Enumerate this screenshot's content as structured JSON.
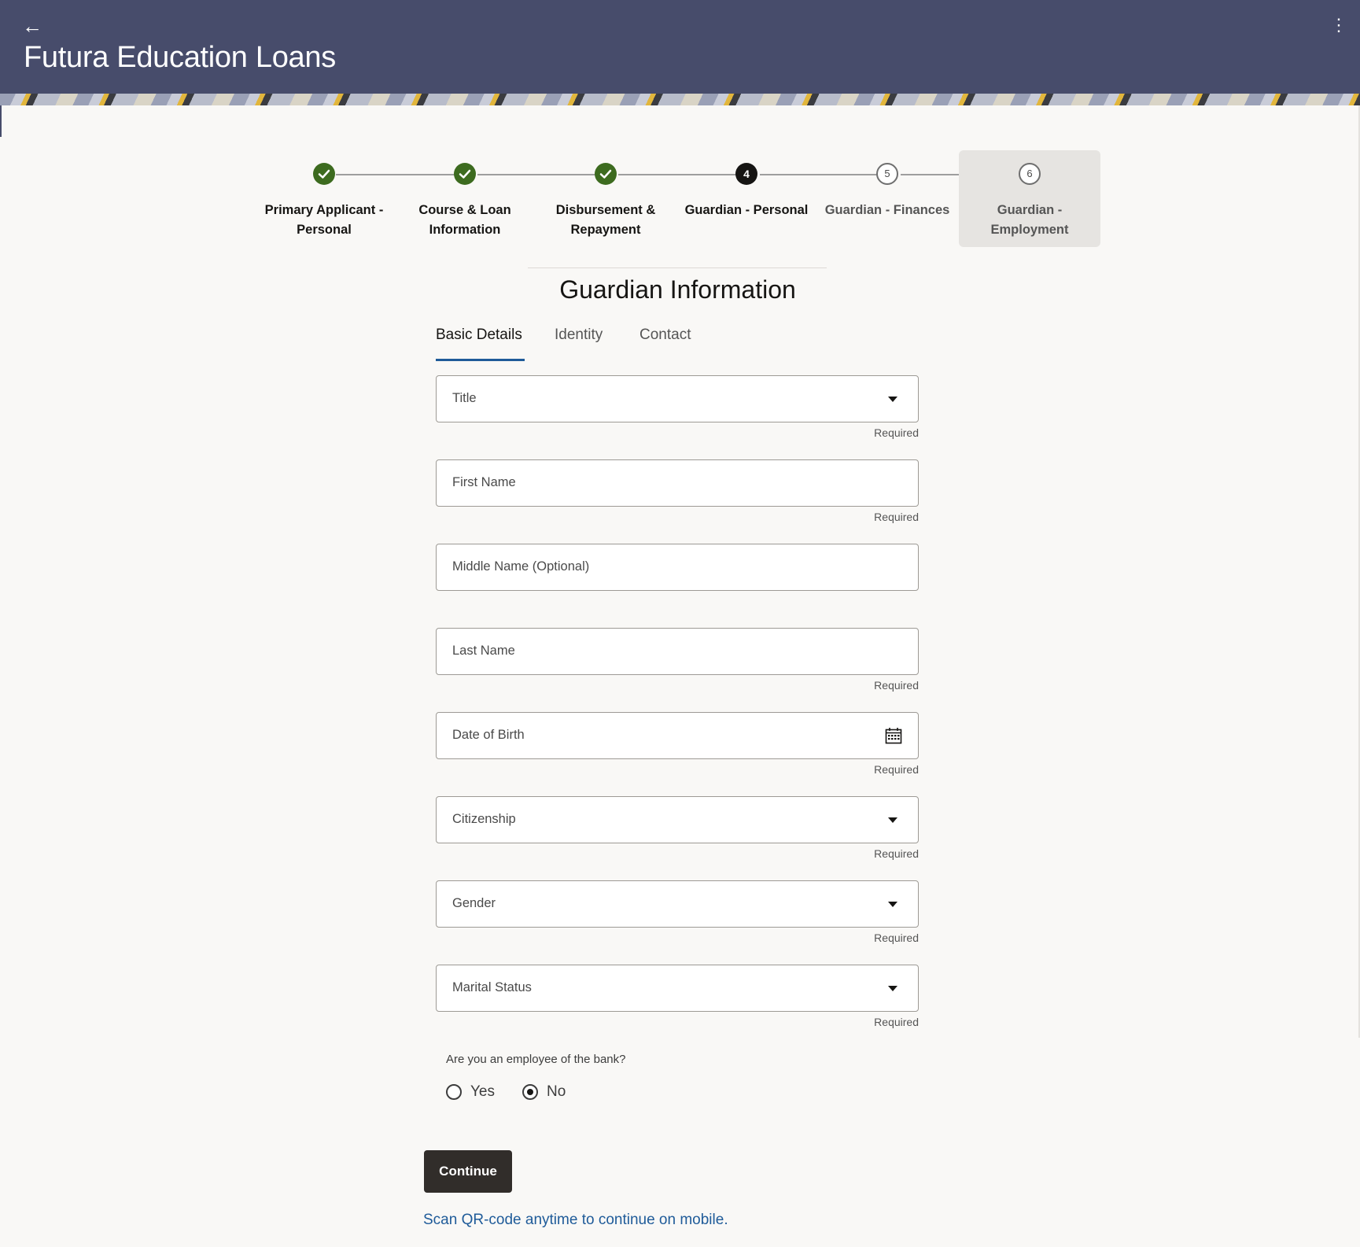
{
  "header": {
    "back_icon": "arrow-left-icon",
    "title": "Futura Education Loans",
    "menu_icon": "more-vertical-icon"
  },
  "stepper": {
    "steps": [
      {
        "label": "Primary Applicant - Personal",
        "state": "done",
        "marker": ""
      },
      {
        "label": "Course & Loan Information",
        "state": "done",
        "marker": ""
      },
      {
        "label": "Disbursement & Repayment",
        "state": "done",
        "marker": ""
      },
      {
        "label": "Guardian - Personal",
        "state": "active",
        "marker": "4"
      },
      {
        "label": "Guardian - Finances",
        "state": "todo",
        "marker": "5"
      },
      {
        "label": "Guardian - Employment",
        "state": "todo",
        "marker": "6"
      }
    ]
  },
  "section": {
    "title": "Guardian Information"
  },
  "tabs": [
    {
      "label": "Basic Details",
      "selected": true
    },
    {
      "label": "Identity",
      "selected": false
    },
    {
      "label": "Contact",
      "selected": false
    }
  ],
  "form": {
    "fields": [
      {
        "label": "Title",
        "type": "select",
        "value": "",
        "helper": "Required"
      },
      {
        "label": "First Name",
        "type": "text",
        "value": "",
        "helper": "Required"
      },
      {
        "label": "Middle Name (Optional)",
        "type": "text",
        "value": "",
        "helper": ""
      },
      {
        "label": "Last Name",
        "type": "text",
        "value": "",
        "helper": "Required"
      },
      {
        "label": "Date of Birth",
        "type": "date",
        "value": "",
        "helper": "Required",
        "icon": "calendar-icon"
      },
      {
        "label": "Citizenship",
        "type": "select",
        "value": "",
        "helper": "Required"
      },
      {
        "label": "Gender",
        "type": "select",
        "value": "",
        "helper": "Required"
      },
      {
        "label": "Marital Status",
        "type": "select",
        "value": "",
        "helper": "Required"
      }
    ],
    "employee_question": "Are you an employee of the bank?",
    "employee_options": [
      {
        "label": "Yes",
        "checked": false
      },
      {
        "label": "No",
        "checked": true
      }
    ]
  },
  "actions": {
    "continue_label": "Continue",
    "qr_link": "Scan QR-code anytime to continue on mobile."
  },
  "colors": {
    "header_bg": "#474c6b",
    "done_step": "#3d6b1f",
    "link": "#1f5b99",
    "button_bg": "#312d2a"
  }
}
